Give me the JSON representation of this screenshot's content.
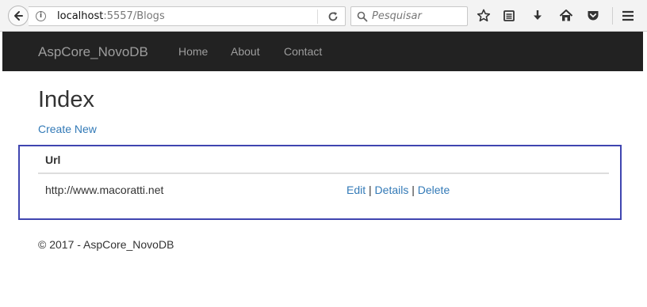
{
  "browser": {
    "url_host": "localhost",
    "url_path": ":5557/Blogs",
    "search_placeholder": "Pesquisar",
    "icons": [
      "back-arrow-icon",
      "info-icon",
      "reload-icon",
      "search-icon",
      "bookmark-star-icon",
      "reading-list-icon",
      "download-icon",
      "home-icon",
      "pocket-icon",
      "menu-icon"
    ]
  },
  "navbar": {
    "brand": "AspCore_NovoDB",
    "links": [
      "Home",
      "About",
      "Contact"
    ],
    "background": "#222222",
    "link_color": "#9d9d9d"
  },
  "main": {
    "title": "Index",
    "create_link": "Create New",
    "table": {
      "headers": [
        "Url"
      ],
      "rows": [
        {
          "url": "http://www.macoratti.net",
          "actions": [
            "Edit",
            "Details",
            "Delete"
          ]
        }
      ]
    },
    "action_separator": "|",
    "link_color": "#337ab7",
    "highlight_color": "#3f45b0"
  },
  "footer": {
    "text": "© 2017 - AspCore_NovoDB"
  }
}
